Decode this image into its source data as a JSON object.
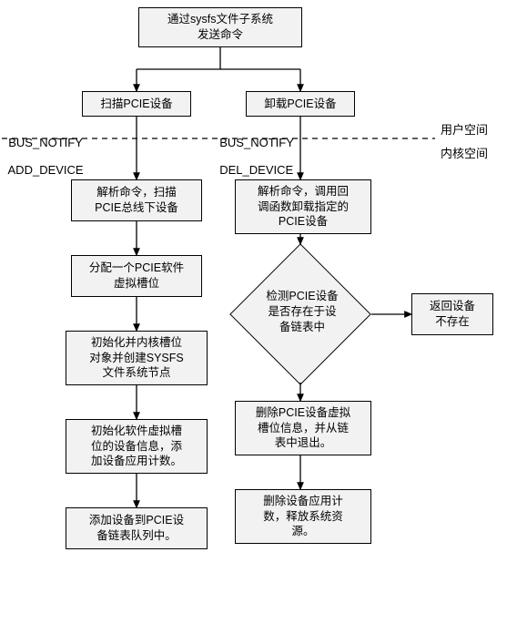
{
  "top": {
    "title_l1": "通过sysfs文件子系统",
    "title_l2": "发送命令"
  },
  "left": {
    "scan": "扫描PCIE设备",
    "parse_l1": "解析命令，扫描",
    "parse_l2": "PCIE总线下设备",
    "alloc_l1": "分配一个PCIE软件",
    "alloc_l2": "虚拟槽位",
    "init_l1": "初始化并内核槽位",
    "init_l2": "对象并创建SYSFS",
    "init_l3": "文件系统节点",
    "vinit_l1": "初始化软件虚拟槽",
    "vinit_l2": "位的设备信息，添",
    "vinit_l3": "加设备应用计数。",
    "add_l1": "添加设备到PCIE设",
    "add_l2": "备链表队列中。"
  },
  "right": {
    "unload": "卸载PCIE设备",
    "parse_l1": "解析命令，调用回",
    "parse_l2": "调函数卸载指定的",
    "parse_l3": "PCIE设备",
    "check_l1": "检测PCIE设备",
    "check_l2": "是否存在于设",
    "check_l3": "备链表中",
    "notexist_l1": "返回设备",
    "notexist_l2": "不存在",
    "delete_l1": "删除PCIE设备虚拟",
    "delete_l2": "槽位信息，并从链",
    "delete_l3": "表中退出。",
    "release_l1": "删除设备应用计",
    "release_l2": "数，释放系统资",
    "release_l3": "源。"
  },
  "labels": {
    "add_device_l1": "BUS_NOTIFY",
    "add_device_l2": "ADD_DEVICE",
    "del_device_l1": "BUS_NOTIFY",
    "del_device_l2": "DEL_DEVICE",
    "user_space": "用户空间",
    "kernel_space": "内核空间"
  }
}
